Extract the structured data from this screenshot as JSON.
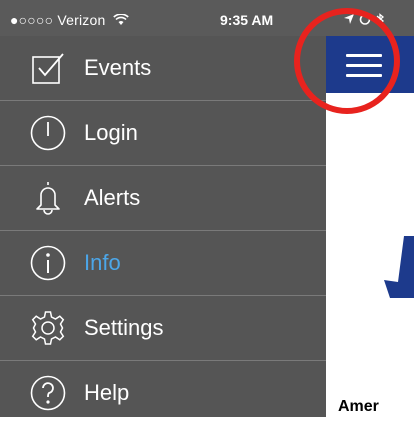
{
  "status_bar": {
    "carrier": "●○○○○ Verizon",
    "wifi_icon": "wifi-icon",
    "time": "9:35 AM",
    "right_icons": [
      "location-icon",
      "alarm-icon",
      "bluetooth-icon"
    ]
  },
  "drawer": {
    "items": [
      {
        "label": "Events",
        "icon": "checkbox-icon",
        "active": false
      },
      {
        "label": "Login",
        "icon": "power-icon",
        "active": false
      },
      {
        "label": "Alerts",
        "icon": "bell-icon",
        "active": false
      },
      {
        "label": "Info",
        "icon": "info-icon",
        "active": true
      },
      {
        "label": "Settings",
        "icon": "gear-icon",
        "active": false
      },
      {
        "label": "Help",
        "icon": "help-icon",
        "active": false
      }
    ]
  },
  "content": {
    "hamburger_icon": "hamburger-menu-icon",
    "partial_text": "Amer"
  },
  "colors": {
    "drawer_bg": "#555555",
    "active_item": "#4ca6e8",
    "top_bar": "#1d3a8c",
    "highlight": "#e8231e"
  }
}
